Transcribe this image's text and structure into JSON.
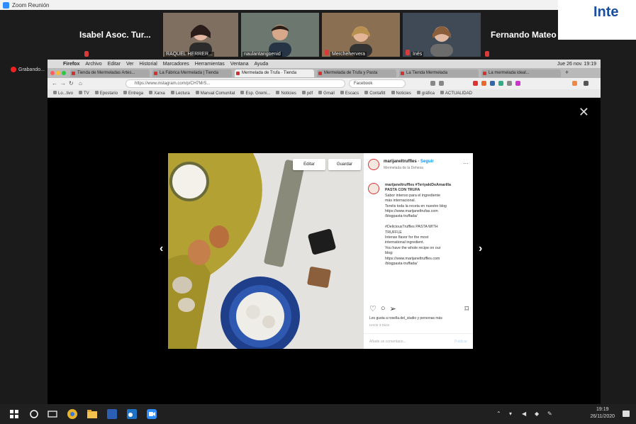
{
  "window": {
    "title": "Zoom Reunión"
  },
  "recording": {
    "label": "Grabando..."
  },
  "brand": {
    "text": "Inte"
  },
  "gallery": {
    "name_left": "Isabel Asoc. Tur...",
    "name_right": "Fernando Mateo",
    "tiles": [
      {
        "label": "RAQUEL HERRER..."
      },
      {
        "label": "naulantangoenid"
      },
      {
        "label": "Merchehervera"
      },
      {
        "label": "Inés"
      }
    ]
  },
  "menubar": {
    "items": [
      "Firefox",
      "Archivo",
      "Editar",
      "Ver",
      "Historial",
      "Marcadores",
      "Herramientas",
      "Ventana",
      "Ayuda"
    ],
    "clock": "Jue 26 nov. 19:19"
  },
  "tabs": [
    {
      "label": "Tienda de Mermeladas Artes..."
    },
    {
      "label": "La Fábrica Mermelada | Tienda"
    },
    {
      "label": "Mermelada de Trufa · Tienda"
    },
    {
      "label": "Mermelada de Trufa y Pasta"
    },
    {
      "label": "La Tienda Mermelada"
    },
    {
      "label": "La mermelada ideal..."
    }
  ],
  "navbar": {
    "url": "https://www.instagram.com/p/CH7MrS...",
    "search": "Facebook"
  },
  "bookmarks": [
    "Lo...tivo",
    "TV",
    "Epostario",
    "Entrega",
    "Xarxa",
    "Lectura",
    "Manual Comunitat",
    "Esp. Gremi...",
    "Noticies",
    "pdf",
    "Gmail",
    "Escacs",
    "Contafitt",
    "Noticies",
    "gráfica",
    "ACTUALIDAD"
  ],
  "modal": {
    "photo_buttons": {
      "edit": "Editar",
      "save": "Guardar"
    },
    "user": "marijaneltruffles",
    "follow": "Seguir",
    "location": "Mermelada de la Dehesa",
    "caption_lines": [
      "marijaneltruffles #TeriyakiDeAmarilla",
      "PASTA CON TRUFA",
      "Sabor intenso para el ingrediente",
      "más internacional.",
      "Tenéis toda la receta en nuestro blog",
      "https://www.marijaneltrufas.com",
      "/blogpasta-truffada/",
      "",
      "#DeliciousTruffles PASTA WITH",
      "TRUFFLE",
      "Intense flavor for the most",
      "international ingredient.",
      "You have the whole recipe on our",
      "blog:",
      "https://www.marijaneltruffles.com",
      "/blogpasta-truffada/"
    ],
    "likes": "Les gusta a rosella.del_studio y personas más",
    "date": "HACE 3 DÍAS",
    "comment_placeholder": "Añade un comentario...",
    "publish": "Publicar"
  },
  "taskbar": {
    "time": "19:19",
    "date": "26/11/2020"
  },
  "colors": {
    "zoom_blue": "#2d8cff",
    "instagram_blue": "#0095f6",
    "brand_blue": "#1a4ea0",
    "recording_red": "#e22222"
  }
}
